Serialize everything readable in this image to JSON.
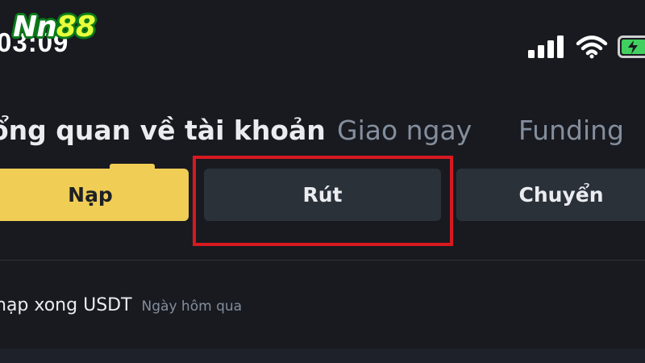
{
  "status_bar": {
    "time": "03:09",
    "icons": [
      "signal-icon",
      "wifi-icon",
      "battery-icon"
    ],
    "battery_color": "#41d05f"
  },
  "logo": {
    "text_main": "Nn",
    "text_accent": "88"
  },
  "tabs": [
    {
      "label": "ổng quan về tài khoản",
      "active": true
    },
    {
      "label": "Giao ngay",
      "active": false
    },
    {
      "label": "Funding",
      "active": false
    }
  ],
  "actions": {
    "deposit": "Nạp",
    "withdraw": "Rút",
    "transfer": "Chuyển"
  },
  "notification": {
    "text": "nạp xong USDT",
    "time": "Ngày hôm qua"
  },
  "colors": {
    "background": "#181a20",
    "accent": "#f0cd55",
    "highlight": "#d71920",
    "button": "#2b3139"
  }
}
